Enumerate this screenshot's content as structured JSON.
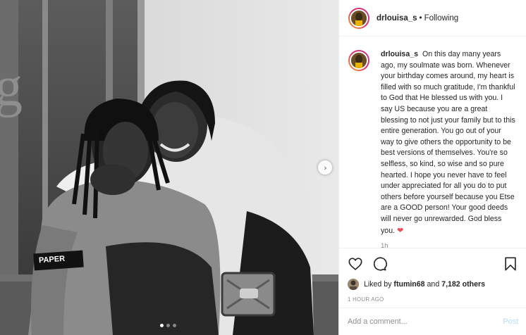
{
  "post": {
    "username": "drlouisa_s",
    "follow_status": "Following",
    "separator": "•",
    "caption": "On this day many years ago, my soulmate was born. Whenever your birthday comes around, my heart is filled with so much gratitude, I'm thankful to God that He blessed us with you. I say US because you are a great blessing to not just your family but to this entire generation. You go out of your way to give others the opportunity to be best versions of themselves. You're so selfless, so kind, so wise and so pure hearted. I hope you never have to feel under appreciated for all you do to put others before yourself because you Etse are a GOOD person! Your good deeds will never go unrewarded. God bless you.",
    "caption_emoji": "❤",
    "relative_time": "1h",
    "liked_by_prefix": "Liked by",
    "liked_by_user": "ftumin68",
    "liked_by_and": "and",
    "liked_by_count": "7,182 others",
    "posted_time": "1 HOUR AGO"
  },
  "photo": {
    "carousel_total": 3,
    "carousel_active_index": 0,
    "jacket_text": "PAPER",
    "next_icon": "chevron-right-icon"
  },
  "composer": {
    "placeholder": "Add a comment...",
    "post_label": "Post"
  },
  "icons": {
    "like": "heart-icon",
    "comment": "comment-icon",
    "save": "bookmark-icon"
  },
  "colors": {
    "story_ring_start": "#f9a825",
    "story_ring_end": "#c13584",
    "heart_emoji": "#ed4956",
    "post_button_disabled": "#b2dffc",
    "secondary_text": "#8e8e8e"
  }
}
